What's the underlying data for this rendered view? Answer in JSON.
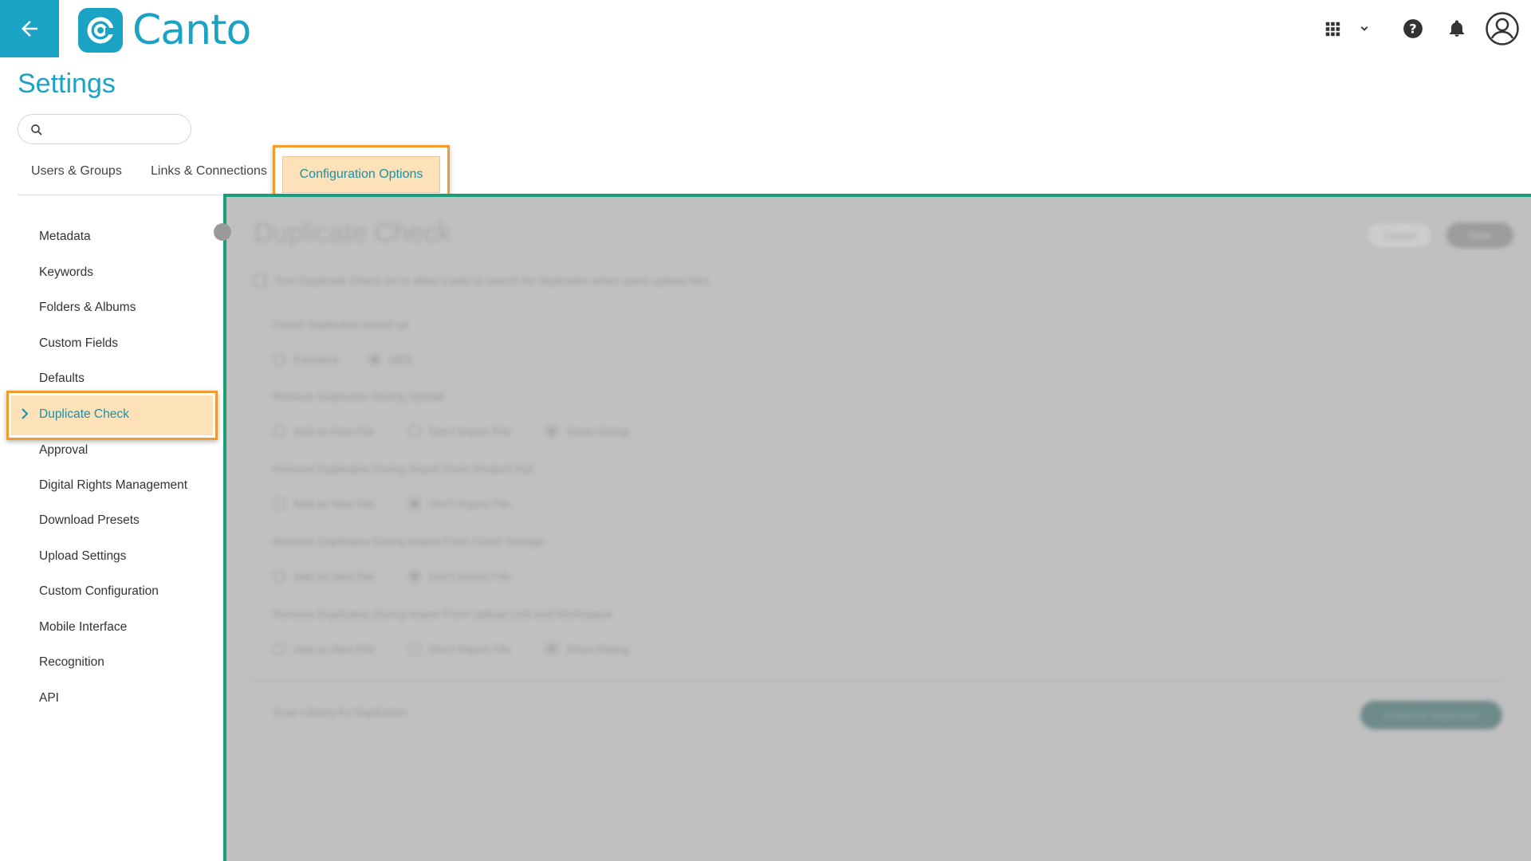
{
  "app": {
    "logo_text": "Canto",
    "brand_color": "#1ba3c6",
    "highlight_color": "#f29a2e",
    "active_fill_color": "#fde1b8",
    "panel_border_color": "#1a9e7a"
  },
  "header": {
    "back_icon": "arrow-left-icon",
    "icons": [
      "apps-grid-icon",
      "chevron-down-icon",
      "help-icon",
      "bell-icon",
      "account-icon"
    ]
  },
  "page": {
    "title": "Settings"
  },
  "search": {
    "value": "",
    "placeholder": ""
  },
  "tabs": [
    {
      "label": "Users & Groups",
      "active": false
    },
    {
      "label": "Links & Connections",
      "active": false
    },
    {
      "label": "Configuration Options",
      "active": true
    }
  ],
  "sidebar": {
    "items": [
      {
        "label": "Metadata"
      },
      {
        "label": "Keywords"
      },
      {
        "label": "Folders & Albums"
      },
      {
        "label": "Custom Fields"
      },
      {
        "label": "Defaults"
      },
      {
        "label": "Duplicate Check",
        "active": true
      },
      {
        "label": "Approval"
      },
      {
        "label": "Digital Rights Management"
      },
      {
        "label": "Download Presets"
      },
      {
        "label": "Upload Settings"
      },
      {
        "label": "Custom Configuration"
      },
      {
        "label": "Mobile Interface"
      },
      {
        "label": "Recognition"
      },
      {
        "label": "API"
      }
    ]
  },
  "content": {
    "title": "Duplicate Check",
    "cancel_label": "Cancel",
    "save_label": "Save",
    "enable_text": "Turn Duplicate Check on to allow Canto to search for duplicates when users upload files",
    "sections": [
      {
        "label": "Check Duplicates based on",
        "options": [
          {
            "label": "Filename",
            "selected": false
          },
          {
            "label": "MD5",
            "selected": true
          }
        ]
      },
      {
        "label": "Remove Duplicates During Upload",
        "options": [
          {
            "label": "Add as New File",
            "selected": false
          },
          {
            "label": "Don't Import File",
            "selected": false
          },
          {
            "label": "Show Dialog",
            "selected": true
          }
        ]
      },
      {
        "label": "Remove Duplicates During Import From Product Hub",
        "options": [
          {
            "label": "Add as New File",
            "selected": false
          },
          {
            "label": "Don't Import File",
            "selected": true
          }
        ]
      },
      {
        "label": "Remove Duplicates During Import From Cloud Storage",
        "options": [
          {
            "label": "Add as New File",
            "selected": false
          },
          {
            "label": "Don't Import File",
            "selected": true
          }
        ]
      },
      {
        "label": "Remove Duplicates During Import From Upload Link and Workspace",
        "options": [
          {
            "label": "Add as New File",
            "selected": false
          },
          {
            "label": "Don't Import File",
            "selected": false
          },
          {
            "label": "Show Dialog",
            "selected": true
          }
        ]
      }
    ],
    "scan_label": "Scan Library for Duplicates",
    "scan_button": "Check for Duplicates"
  }
}
